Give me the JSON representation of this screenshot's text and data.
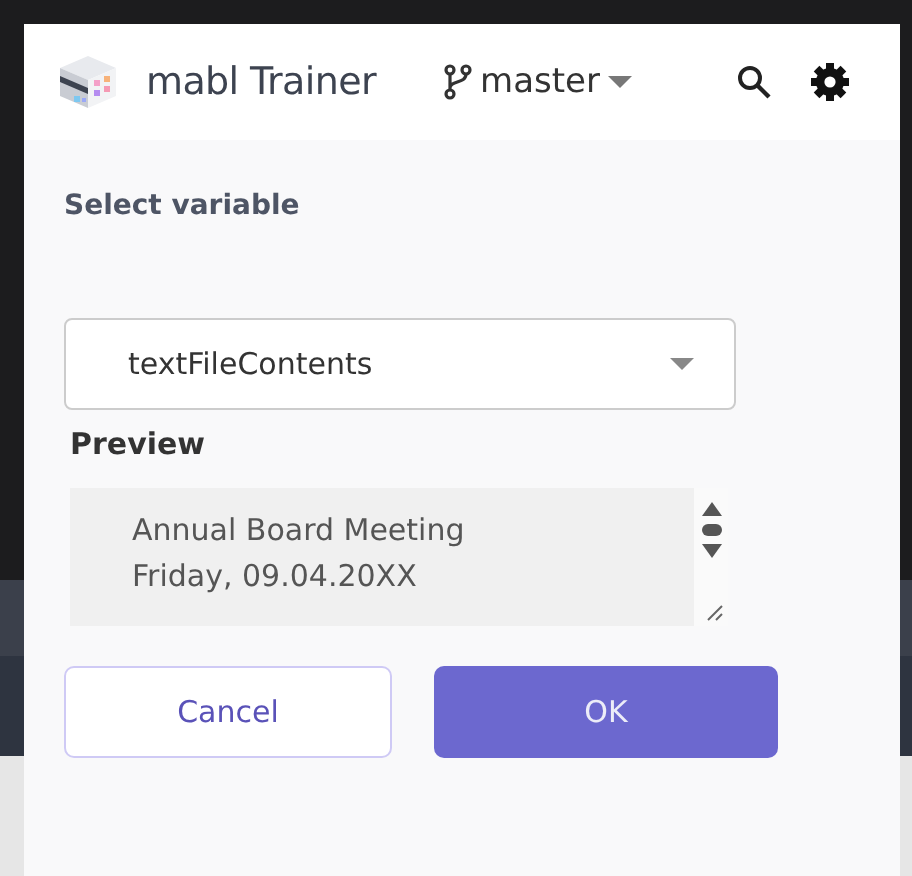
{
  "header": {
    "app_name": "mabl Trainer",
    "branch": "master"
  },
  "dialog": {
    "title": "Select variable",
    "variable": {
      "value": "textFileContents"
    },
    "preview_label": "Preview",
    "preview_lines": [
      "Annual Board Meeting",
      "Friday, 09.04.20XX"
    ]
  },
  "buttons": [
    {
      "label": "Cancel",
      "kind": "secondary"
    },
    {
      "label": "OK",
      "kind": "primary"
    }
  ]
}
